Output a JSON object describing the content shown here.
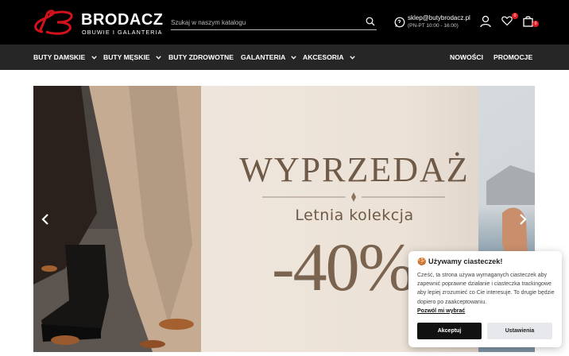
{
  "header": {
    "brand": "BRODACZ",
    "tagline": "OBUWIE I GALANTERIA",
    "search_placeholder": "Szukaj w naszym katalogu",
    "email": "sklep@butybrodacz.pl",
    "hours": "(PN-PT 10:00 - 16:00)",
    "wishlist_count": "0",
    "cart_count": "0",
    "accent_color": "#e01b22"
  },
  "nav": {
    "items": [
      {
        "label": "BUTY DAMSKIE"
      },
      {
        "label": "BUTY MĘSKIE"
      },
      {
        "label": "BUTY ZDROWOTNE"
      },
      {
        "label": "GALANTERIA"
      },
      {
        "label": "AKCESORIA"
      },
      {
        "label": "NOWOŚCI"
      },
      {
        "label": "PROMOCJE"
      }
    ]
  },
  "hero": {
    "title": "WYPRZEDAŻ",
    "subtitle": "Letnia kolekcja",
    "discount": "-40%"
  },
  "cookie": {
    "title": "🍪 Używamy ciasteczek!",
    "body": "Cześć, ta strona używa wymaganych ciasteczek aby zapewnić poprawne działanie i ciasteczka trackingowe aby lepiej zrozumieć co Cie interesuje. To drugie będzie dopiero po zaakceptowaniu.",
    "link": "Pozwól mi wybrać",
    "accept": "Akceptuj",
    "settings": "Ustawienia"
  }
}
